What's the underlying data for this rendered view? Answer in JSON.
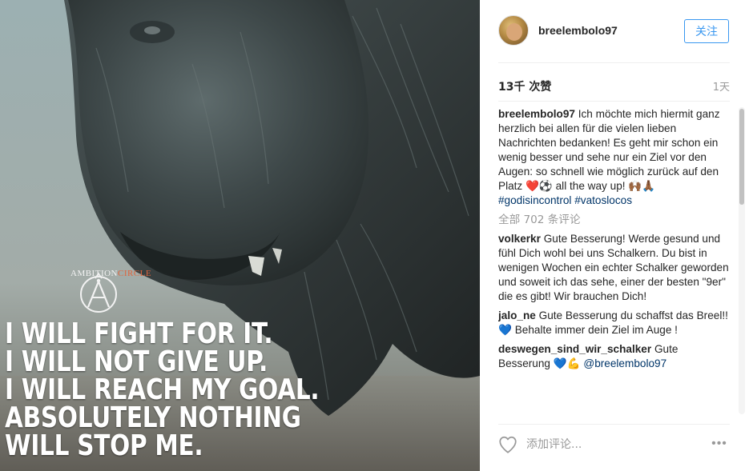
{
  "photo": {
    "logo_prefix": "AMBITION",
    "logo_accent": "CIRCLE",
    "quote_lines": [
      "I WILL FIGHT FOR IT.",
      "I WILL NOT GIVE UP.",
      "I WILL REACH MY GOAL.",
      "ABSOLUTELY NOTHING",
      "WILL STOP ME."
    ]
  },
  "header": {
    "username": "breelembolo97",
    "follow_label": "关注"
  },
  "stats": {
    "likes": "13千 次赞",
    "time": "1天"
  },
  "caption": {
    "user": "breelembolo97",
    "text": "Ich möchte mich hiermit ganz herzlich bei allen für die vielen lieben Nachrichten bedanken! Es geht mir schon ein wenig besser und sehe nur ein Ziel vor den Augen: so schnell wie möglich zurück auf den Platz ❤️⚽ all the way up! 🙌🏾🙏🏾",
    "tag1": "#godisincontrol",
    "tag2": "#vatoslocos"
  },
  "load_more": "全部 702 条评论",
  "comments": [
    {
      "user": "volkerkr",
      "text": "Gute Besserung! Werde gesund und fühl Dich wohl bei uns Schalkern. Du bist in wenigen Wochen ein echter Schalker geworden und soweit ich das sehe, einer der besten \"9er\" die es gibt! Wir brauchen Dich!"
    },
    {
      "user": "jalo_ne",
      "text": "Gute Besserung du schaffst das Breel!!💙 Behalte immer dein Ziel im Auge !"
    },
    {
      "user": "deswegen_sind_wir_schalker",
      "text": "Gute Besserung 💙💪",
      "mention": "@breelembolo97"
    }
  ],
  "footer": {
    "comment_placeholder": "添加评论...",
    "more_label": "•••"
  },
  "colors": {
    "accent": "#3897f0",
    "link": "#003569",
    "muted": "#999999",
    "logo_accent": "#e0643c"
  },
  "icons": [
    "heart-icon",
    "more-options-icon",
    "avatar"
  ]
}
